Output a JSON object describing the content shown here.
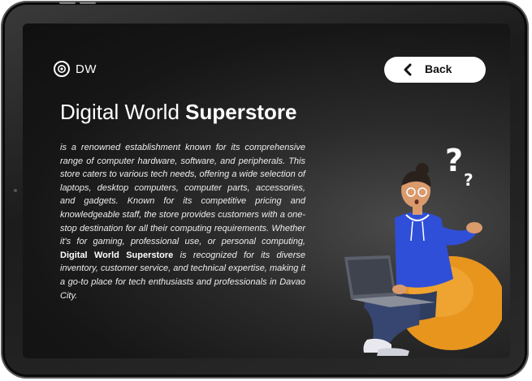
{
  "brand": {
    "logo_text": "DW"
  },
  "header": {
    "back_label": "Back"
  },
  "hero": {
    "title_light": "Digital World",
    "title_bold": "Superstore",
    "desc_part1": "is a renowned establishment known for its comprehensive range of computer hardware, software, and peripherals. This store caters to various tech needs, offering a wide selection of laptops, desktop computers, computer parts, accessories, and gadgets. Known for its competitive pricing and knowledgeable staff, the store provides customers with a one-stop destination for all their computing requirements. Whether it's for gaming, professional use, or personal computing,",
    "desc_bold": "Digital World Superstore",
    "desc_part2": "is recognized for its diverse inventory, customer service, and technical expertise, making it a go-to place for tech enthusiasts and professionals in Davao City."
  },
  "colors": {
    "hoodie": "#2f4fd8",
    "beanbag": "#e8951e",
    "background": "#1a1a1a",
    "button": "#ffffff"
  },
  "icons": {
    "logo": "aperture-logo-icon",
    "back": "chevron-left-icon",
    "illustration": "confused-person-laptop-illustration"
  }
}
